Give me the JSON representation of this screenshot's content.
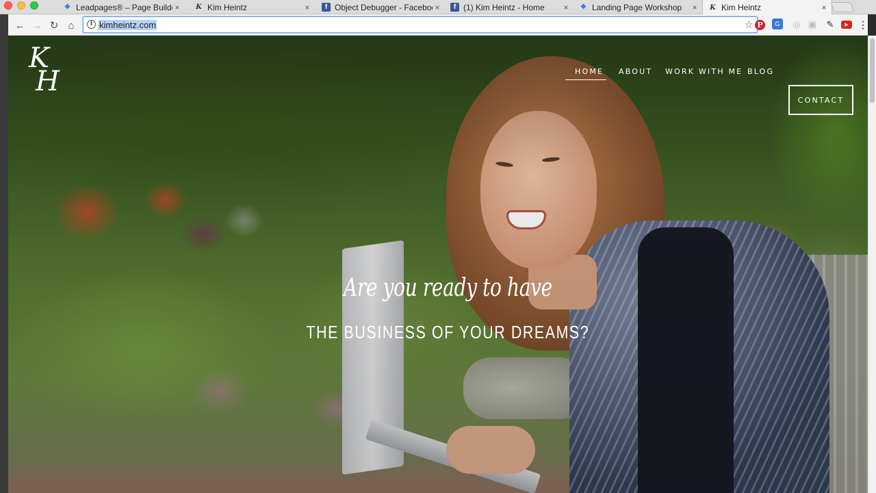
{
  "browser": {
    "tabs": [
      {
        "title": "Leadpages® – Page Builder",
        "favicon": "leadpages-icon",
        "active": false
      },
      {
        "title": "Kim Heintz",
        "favicon": "kh-logo-icon",
        "active": false
      },
      {
        "title": "Object Debugger - Facebook",
        "favicon": "facebook-icon",
        "active": false
      },
      {
        "title": "(1) Kim Heintz - Home",
        "favicon": "facebook-icon",
        "active": false
      },
      {
        "title": "Landing Page Workshop",
        "favicon": "leadpages-icon",
        "active": false
      },
      {
        "title": "Kim Heintz",
        "favicon": "kh-logo-icon",
        "active": true
      }
    ],
    "address_bar": {
      "url": "kimheintz.com"
    },
    "glyphs": {
      "close": "×",
      "back": "←",
      "forward": "→",
      "reload": "↻",
      "home": "⌂",
      "info": "i",
      "star": "☆",
      "pinterest": "P",
      "grammarly": "G",
      "ext1": "◎",
      "ext2": "▣",
      "pen": "✎",
      "youtube": "▶",
      "menu": "⋮",
      "fb": "f",
      "lp": "❖",
      "kh": "K"
    }
  },
  "site": {
    "logo": {
      "line1": "K",
      "line2": "H"
    },
    "nav": {
      "home": "HOME",
      "about": "ABOUT",
      "work": "WORK WITH ME",
      "blog": "BLOG",
      "contact": "CONTACT"
    },
    "hero": {
      "script": "Are you ready to have",
      "headline": "THE BUSINESS OF YOUR DREAMS?"
    }
  },
  "colors": {
    "accent_blue": "#6d9ff3",
    "nav_text": "#ffffff"
  }
}
